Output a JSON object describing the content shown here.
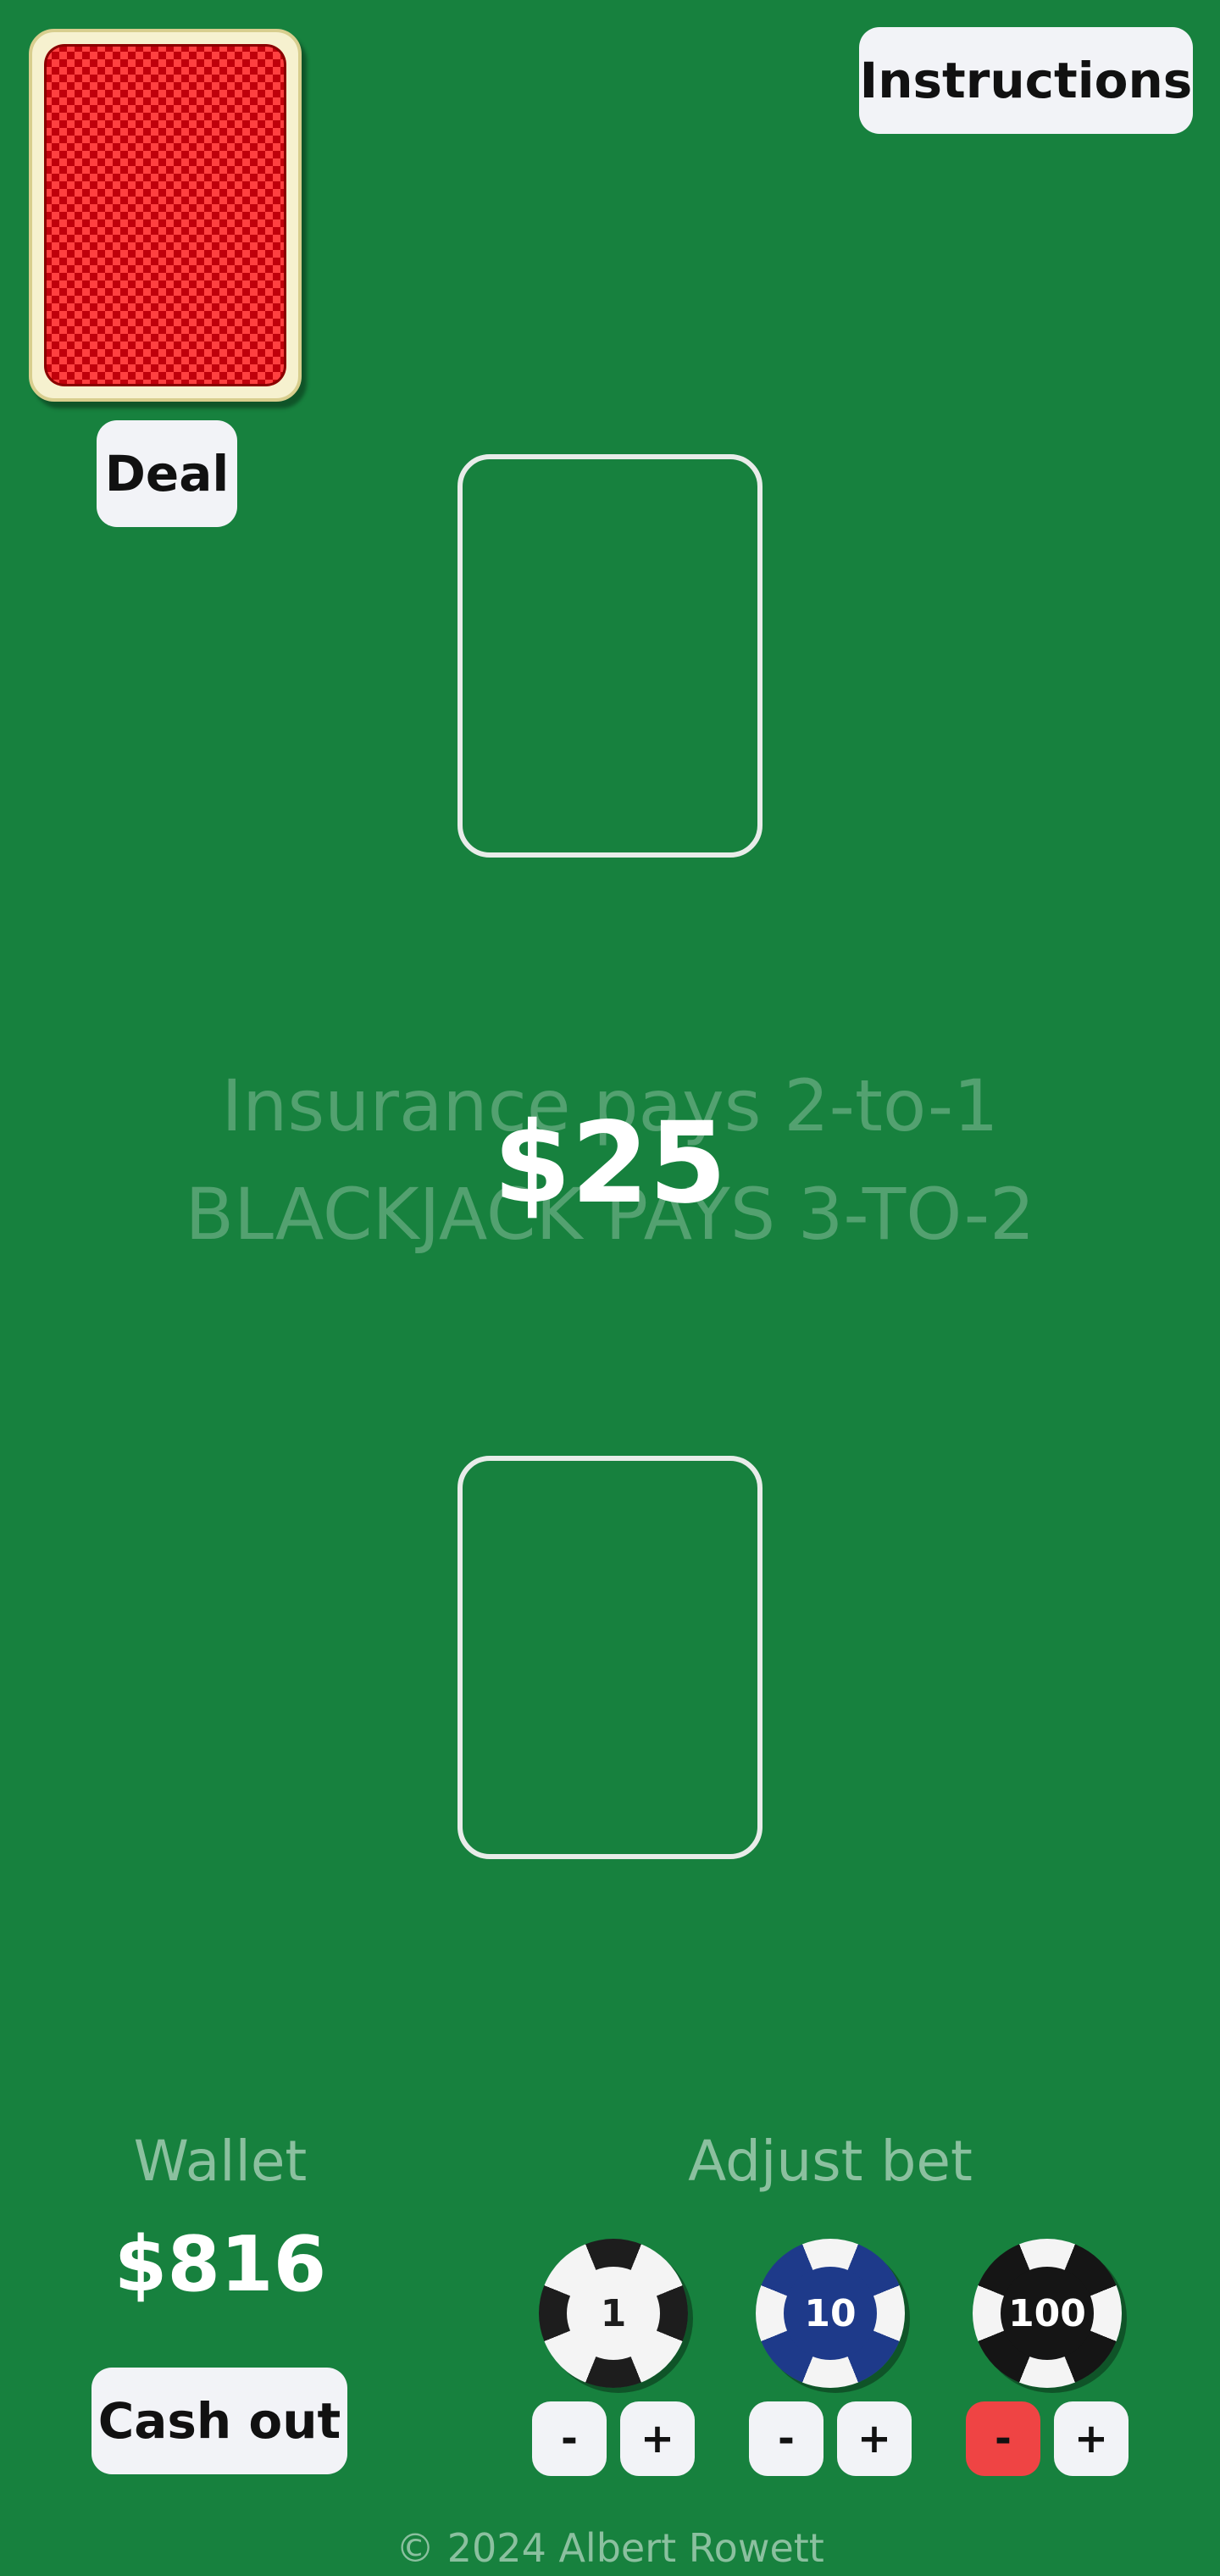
{
  "header": {
    "instructions_label": "Instructions"
  },
  "deck": {
    "deal_label": "Deal",
    "card_back_color": "#c0000b"
  },
  "table": {
    "insurance_text": "Insurance pays 2-to-1",
    "blackjack_text": "BLACKJACK PAYS 3-TO-2",
    "current_bet": "$25",
    "felt_color": "#17813e"
  },
  "wallet": {
    "label": "Wallet",
    "amount": "$816",
    "cash_out_label": "Cash out"
  },
  "bet_controls": {
    "label": "Adjust bet",
    "chips": [
      {
        "value": "1",
        "color": "#1d1d1d",
        "decrement_label": "-",
        "increment_label": "+"
      },
      {
        "value": "10",
        "color": "#1e3a8a",
        "decrement_label": "-",
        "increment_label": "+"
      },
      {
        "value": "100",
        "color": "#151515",
        "decrement_label": "-",
        "increment_label": "+"
      }
    ],
    "disabled_decrement_color": "#ef4444"
  },
  "footer": {
    "copyright": "© 2024 Albert Rowett"
  }
}
